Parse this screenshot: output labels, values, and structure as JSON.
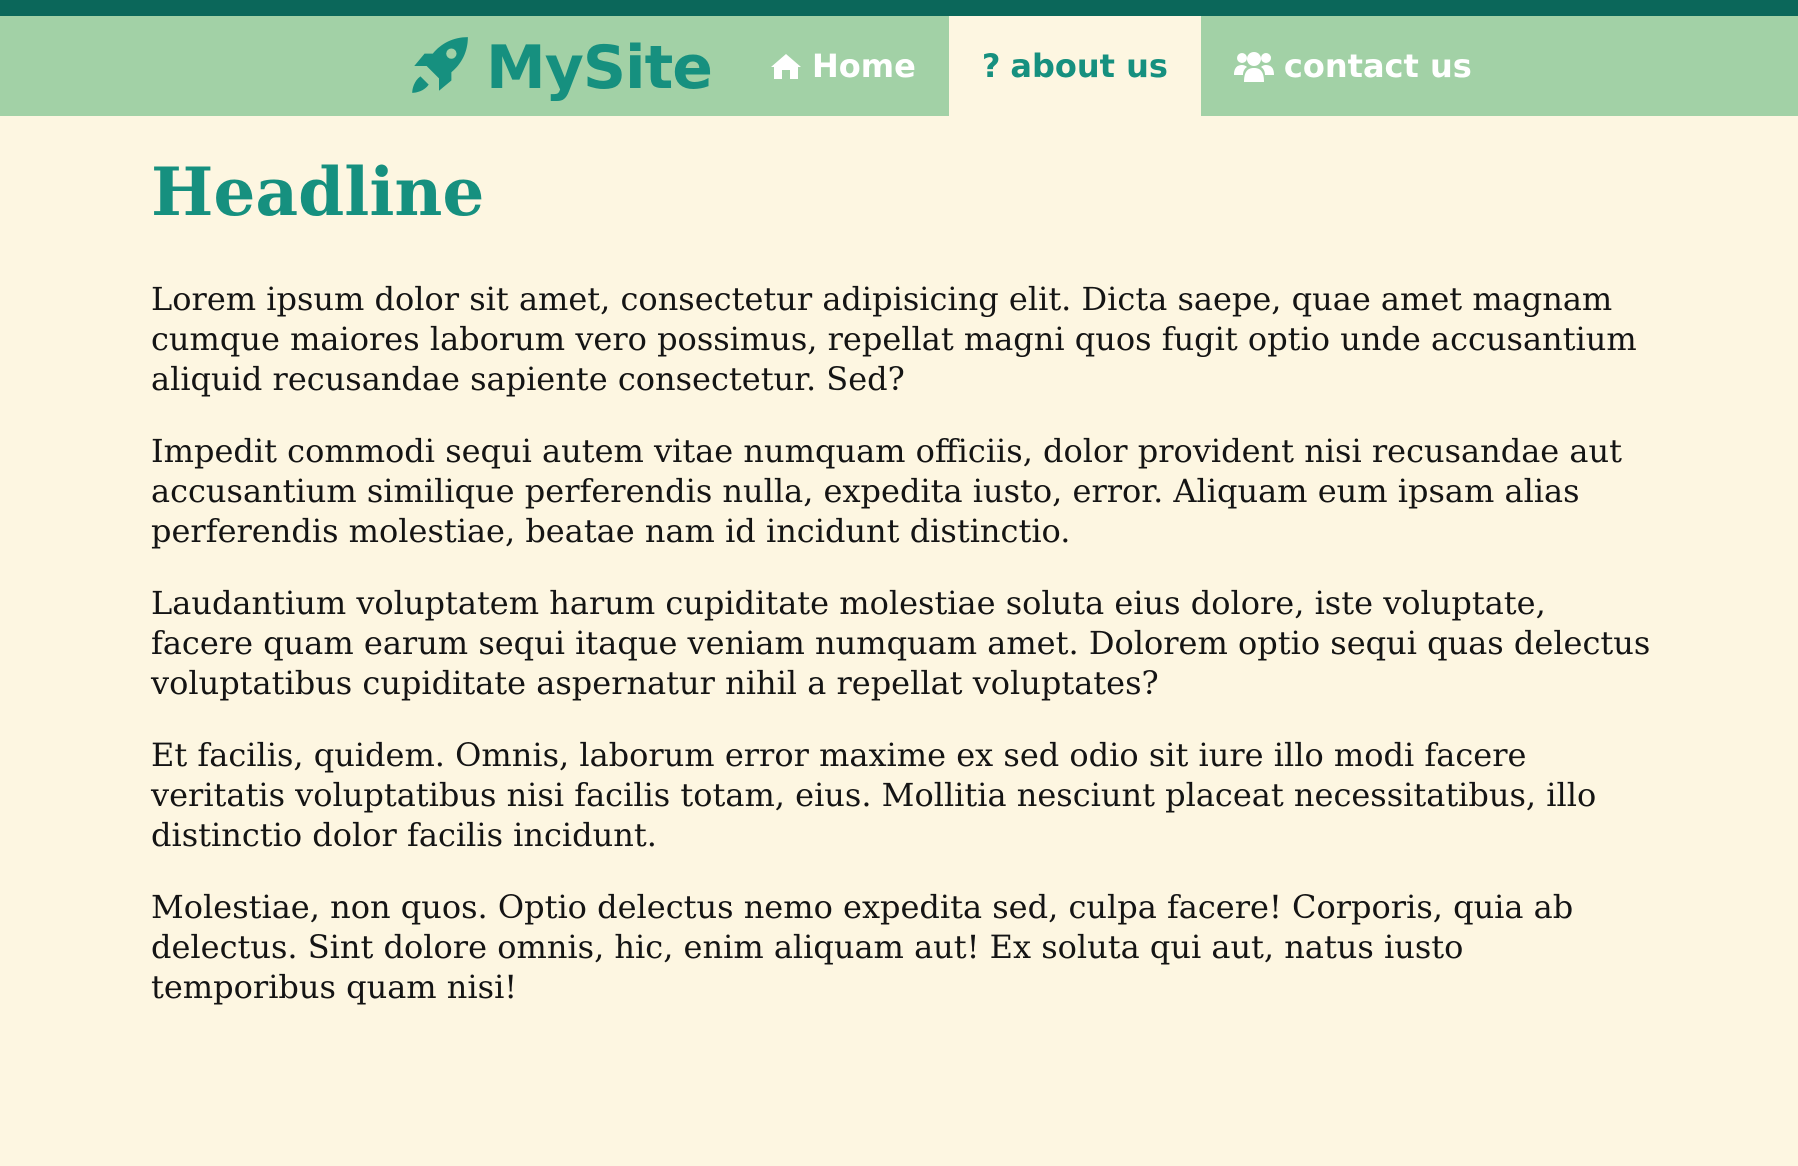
{
  "site": {
    "name": "MySite",
    "logo_icon": "rocket-icon",
    "colors": {
      "top_strip": "#0b675a",
      "navbar": "#a2d1a6",
      "accent": "#16907f",
      "page_background": "#fdf6e1",
      "body_text": "#141414"
    }
  },
  "nav": {
    "items": [
      {
        "label": "Home",
        "icon": "home-icon",
        "active": false
      },
      {
        "label": "about us",
        "icon": "question-icon",
        "active": true
      },
      {
        "label": "contact us",
        "icon": "users-icon",
        "active": false
      }
    ]
  },
  "main": {
    "headline": "Headline",
    "paragraphs": [
      "Lorem ipsum dolor sit amet, consectetur adipisicing elit. Dicta saepe, quae amet magnam cumque maiores laborum vero possimus, repellat magni quos fugit optio unde accusantium aliquid recusandae sapiente consectetur. Sed?",
      "Impedit commodi sequi autem vitae numquam officiis, dolor provident nisi recusandae aut accusantium similique perferendis nulla, expedita iusto, error. Aliquam eum ipsam alias perferendis molestiae, beatae nam id incidunt distinctio.",
      "Laudantium voluptatem harum cupiditate molestiae soluta eius dolore, iste voluptate, facere quam earum sequi itaque veniam numquam amet. Dolorem optio sequi quas delectus voluptatibus cupiditate aspernatur nihil a repellat voluptates?",
      "Et facilis, quidem. Omnis, laborum error maxime ex sed odio sit iure illo modi facere veritatis voluptatibus nisi facilis totam, eius. Mollitia nesciunt placeat necessitatibus, illo distinctio dolor facilis incidunt.",
      "Molestiae, non quos. Optio delectus nemo expedita sed, culpa facere! Corporis, quia ab delectus. Sint dolore omnis, hic, enim aliquam aut! Ex soluta qui aut, natus iusto temporibus quam nisi!"
    ]
  }
}
